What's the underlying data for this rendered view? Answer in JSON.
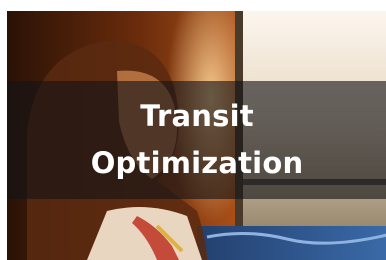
{
  "card": {
    "title": "Transit\nOptimization",
    "image_icon": "bus-window-photo",
    "overlay_color": "#141416"
  }
}
